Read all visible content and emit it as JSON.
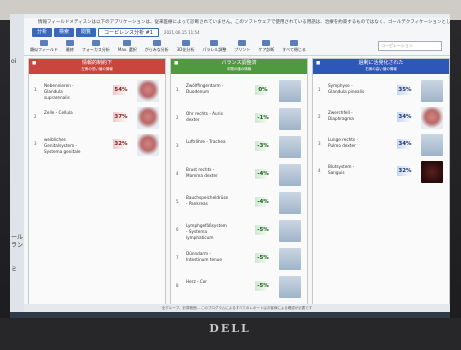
{
  "app": {
    "info_text": "情報フィールドメディスンは以下のアプリケーションは、従来医療によって診断されていません。このソフトウェアで使用されている用語は、治療を約束するものではなく、ゴールデクフィケーションとして理解されるべきです。",
    "tabs": [
      {
        "label": "分析"
      },
      {
        "label": "検索"
      },
      {
        "label": "閲覧"
      },
      {
        "label": "コーピレンス分析 #1"
      }
    ],
    "tab_date": "2021.06.15 11:54"
  },
  "ribbon": {
    "items": [
      {
        "label": "類似フィールド"
      },
      {
        "label": "最終"
      },
      {
        "label": "フォーカス分析"
      },
      {
        "label": "Max. 選択"
      },
      {
        "label": "がらみな分析"
      },
      {
        "label": "3D化分析"
      },
      {
        "label": "パラレル調整"
      },
      {
        "label": "プリント"
      },
      {
        "label": "ケア診断"
      },
      {
        "label": "すべて閉じる"
      }
    ],
    "search_placeholder": "コーピレーション"
  },
  "desktop": {
    "labels": [
      "oi",
      "ール",
      "ラン",
      "ミ"
    ]
  },
  "columns": [
    {
      "title": "情報的制約下",
      "subtitle": "左側の低い値の情報",
      "color": "#c8463c",
      "items": [
        {
          "idx": "1",
          "name": "Nebennieren - Glandula suprarenalis",
          "pct": "54%"
        },
        {
          "idx": "2",
          "name": "Zelle - Cellula",
          "pct": "37%"
        },
        {
          "idx": "3",
          "name": "weibliches Genitalsystem - Systema genitale",
          "pct": "32%"
        }
      ]
    },
    {
      "title": "バランス調整済",
      "subtitle": "中間の値の情報",
      "color": "#4f9a3f",
      "items": [
        {
          "idx": "1",
          "name": "Zwölffingerdarm - Duodenum",
          "pct": "0%"
        },
        {
          "idx": "2",
          "name": "Ohr rechts - Auris dexter",
          "pct": "-1%"
        },
        {
          "idx": "3",
          "name": "Luftröhre - Trachea",
          "pct": "-3%"
        },
        {
          "idx": "4",
          "name": "Brust rechts - Mamma dexter",
          "pct": "-4%"
        },
        {
          "idx": "5",
          "name": "Bauchspeicheldrüse - Pankreas",
          "pct": "-4%"
        },
        {
          "idx": "6",
          "name": "Lymphgefäßsystem - Systema lymphaticum",
          "pct": "-5%"
        },
        {
          "idx": "7",
          "name": "Dünndarm - Intestinum tenue",
          "pct": "-5%"
        },
        {
          "idx": "8",
          "name": "Herz - Cor",
          "pct": "-5%"
        }
      ]
    },
    {
      "title": "過剰に活発化された",
      "subtitle": "右側の高い値の情報",
      "color": "#2e58b8",
      "items": [
        {
          "idx": "1",
          "name": "Symphyse - Glandula pinealis",
          "pct": "35%"
        },
        {
          "idx": "2",
          "name": "Zwerchfell - Diaphragma",
          "pct": "34%"
        },
        {
          "idx": "3",
          "name": "Lunge rechts - Pulmo dexter",
          "pct": "34%"
        },
        {
          "idx": "4",
          "name": "Blutsystem - Sanguis",
          "pct": "32%"
        }
      ]
    }
  ],
  "status_text": "全グループ、計算範囲... このプログラムによるすべてのレポートはお客様による確認が必要です",
  "logo_text": "DELL"
}
